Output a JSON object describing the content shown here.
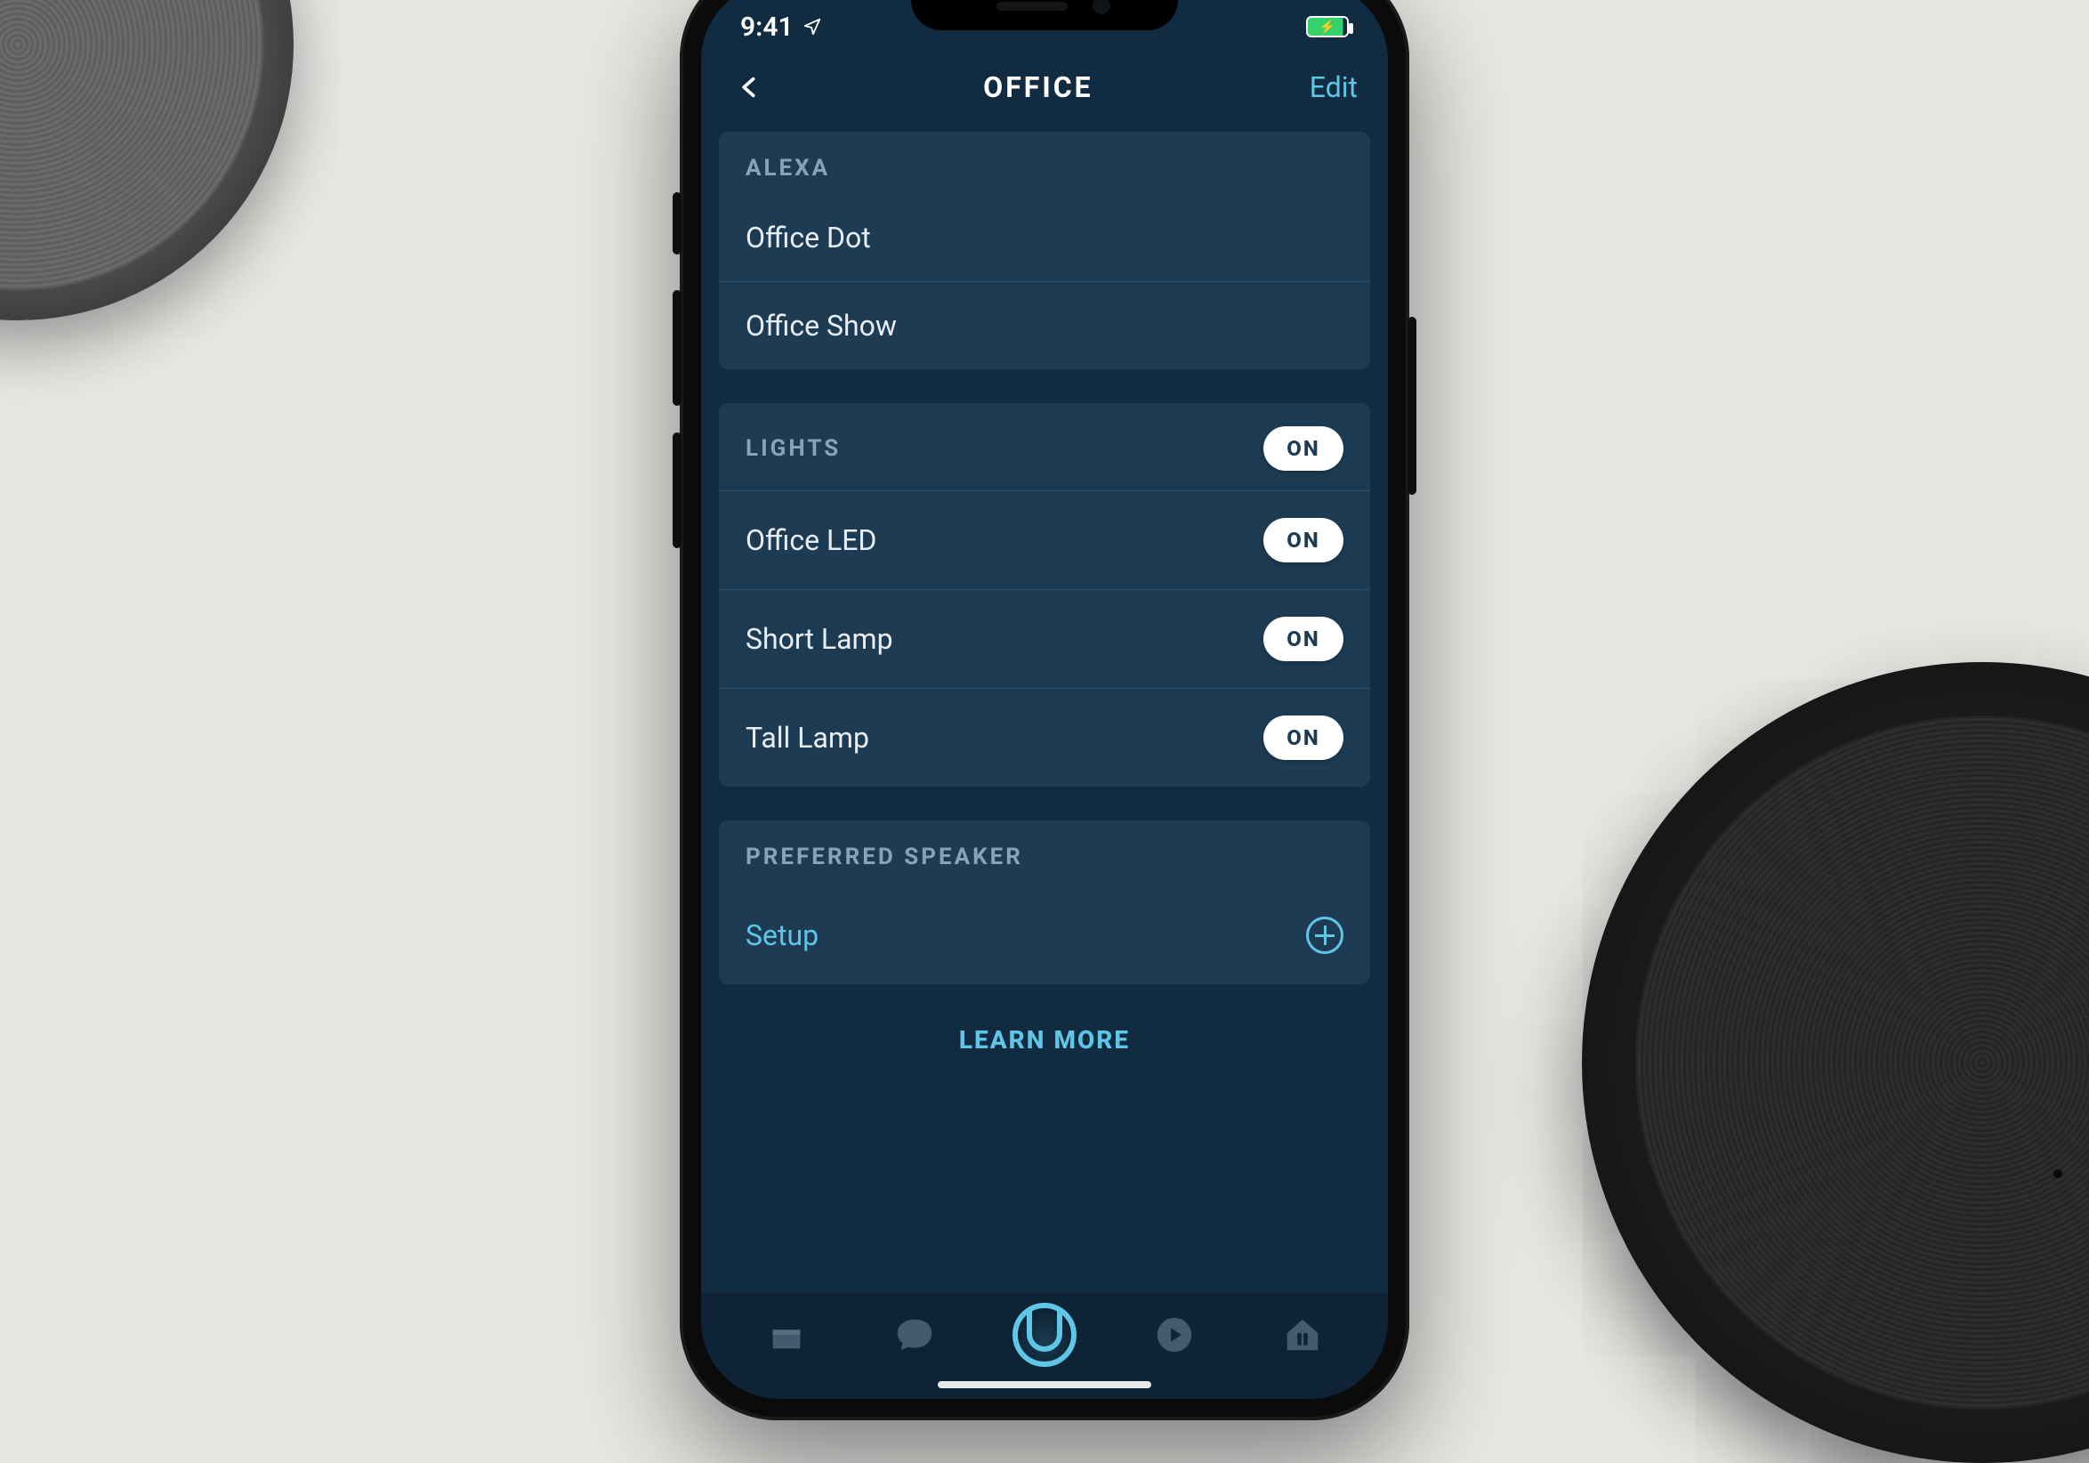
{
  "statusbar": {
    "time": "9:41"
  },
  "nav": {
    "title": "OFFICE",
    "edit": "Edit"
  },
  "sections": {
    "alexa": {
      "heading": "ALEXA",
      "items": [
        "Office Dot",
        "Office Show"
      ]
    },
    "lights": {
      "heading": "LIGHTS",
      "all_state": "ON",
      "items": [
        {
          "name": "Office LED",
          "state": "ON"
        },
        {
          "name": "Short Lamp",
          "state": "ON"
        },
        {
          "name": "Tall Lamp",
          "state": "ON"
        }
      ]
    },
    "speaker": {
      "heading": "PREFERRED SPEAKER",
      "action": "Setup"
    }
  },
  "learn_more": "LEARN MORE",
  "colors": {
    "accent": "#5fc6e8",
    "screen_bg": "#112b40",
    "card": "#1d3c54"
  }
}
